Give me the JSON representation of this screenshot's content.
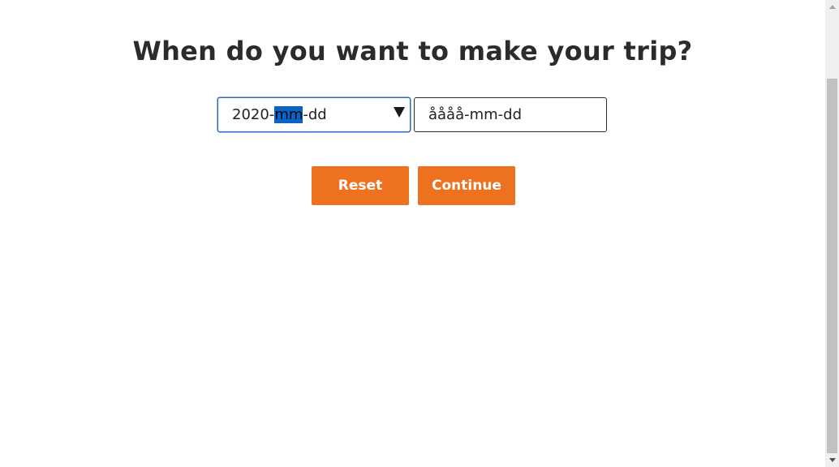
{
  "heading": "When do you want to make your trip?",
  "start_date": {
    "prefix": "2020-",
    "selected_segment": "mm",
    "suffix": "-dd"
  },
  "end_date": {
    "text": "åååå-mm-dd"
  },
  "buttons": {
    "reset_label": "Reset",
    "continue_label": "Continue"
  },
  "colors": {
    "accent": "#ee7120",
    "focus_border": "#2f66c7",
    "selection": "#0a63c9"
  },
  "icons": {
    "dropdown": "triangle-down",
    "scroll_up": "arrow-up",
    "scroll_down": "arrow-down"
  }
}
